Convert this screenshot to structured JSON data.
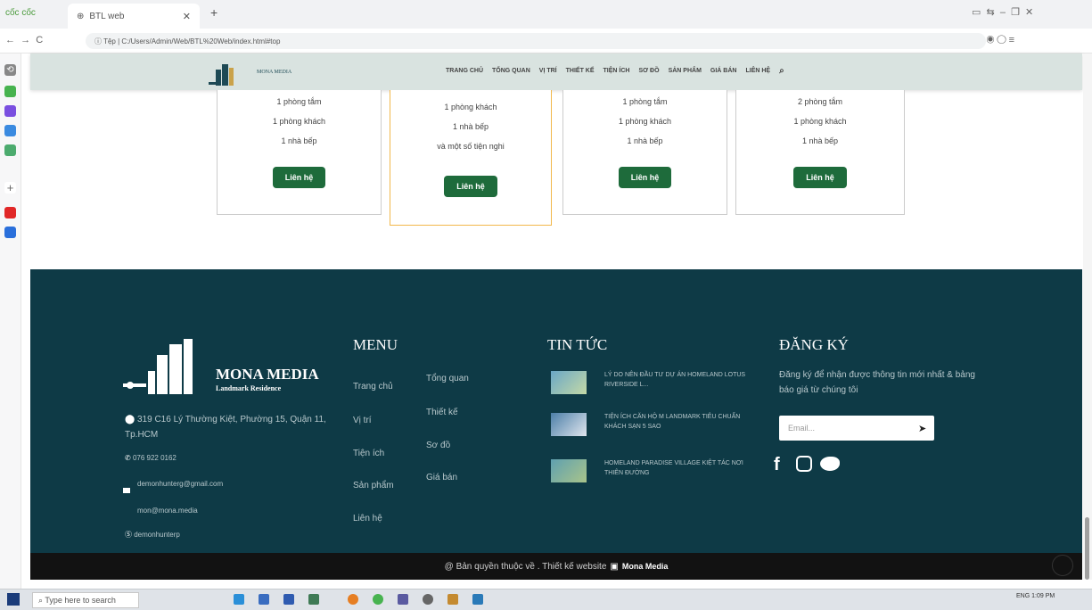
{
  "browser": {
    "app_name": "cốc cốc",
    "tab_title": "BTL web",
    "url_prefix": "Tệp",
    "url": "C:/Users/Admin/Web/BTL%20Web/index.html#top"
  },
  "site": {
    "logo_text": "MONA MEDIA",
    "nav": [
      "TRANG CHỦ",
      "TỔNG QUAN",
      "VỊ TRÍ",
      "THIẾT KẾ",
      "TIỆN ÍCH",
      "SƠ ĐỒ",
      "SẢN PHẨM",
      "GIÁ BÁN",
      "LIÊN HỆ"
    ]
  },
  "cards": [
    {
      "lines": [
        "1 phòng tắm",
        "1 phòng khách",
        "1 nhà bếp"
      ],
      "button": "Liên hệ"
    },
    {
      "lines": [
        "1 phòng khách",
        "1 nhà bếp",
        "và một số tiện nghi"
      ],
      "button": "Liên hệ"
    },
    {
      "lines": [
        "1 phòng tắm",
        "1 phòng khách",
        "1 nhà bếp"
      ],
      "button": "Liên hệ"
    },
    {
      "lines": [
        "2 phòng tắm",
        "1 phòng khách",
        "1 nhà bếp"
      ],
      "button": "Liên hệ"
    }
  ],
  "footer": {
    "brand": "MONA MEDIA",
    "brand_sub": "Landmark Residence",
    "address": "319 C16 Lý Thường Kiệt, Phường 15, Quận 11, Tp.HCM",
    "phone": "076 922 0162",
    "email1": "demonhunterg@gmail.com",
    "email2": "mon@mona.media",
    "skype": "demonhunterp",
    "menu_title": "MENU",
    "menu_col1": [
      "Trang chủ",
      "Vị trí",
      "Tiện ích",
      "Sản phẩm",
      "Liên hệ"
    ],
    "menu_col2": [
      "Tổng quan",
      "Thiết kế",
      "Sơ đồ",
      "Giá bán"
    ],
    "news_title": "TIN TỨC",
    "news": [
      "LÝ DO NÊN ĐẦU TƯ DỰ ÁN HOMELAND LOTUS RIVERSIDE L...",
      "TIỆN ÍCH CĂN HỘ M LANDMARK TIÊU CHUẨN KHÁCH SẠN 5 SAO",
      "HOMELAND PARADISE VILLAGE KIỆT TÁC NƠI THIÊN ĐƯỜNG"
    ],
    "signup_title": "ĐĂNG KÝ",
    "signup_text": "Đăng ký để nhận được thông tin mới nhất & bảng báo giá từ chúng tôi",
    "email_placeholder": "Email..."
  },
  "copyright": {
    "text": "@ Bản quyền thuộc về . Thiết kế website",
    "brand": "Mona Media"
  },
  "taskbar": {
    "search_placeholder": "Type here to search",
    "time": "1:09 PM",
    "lang": "ENG"
  }
}
